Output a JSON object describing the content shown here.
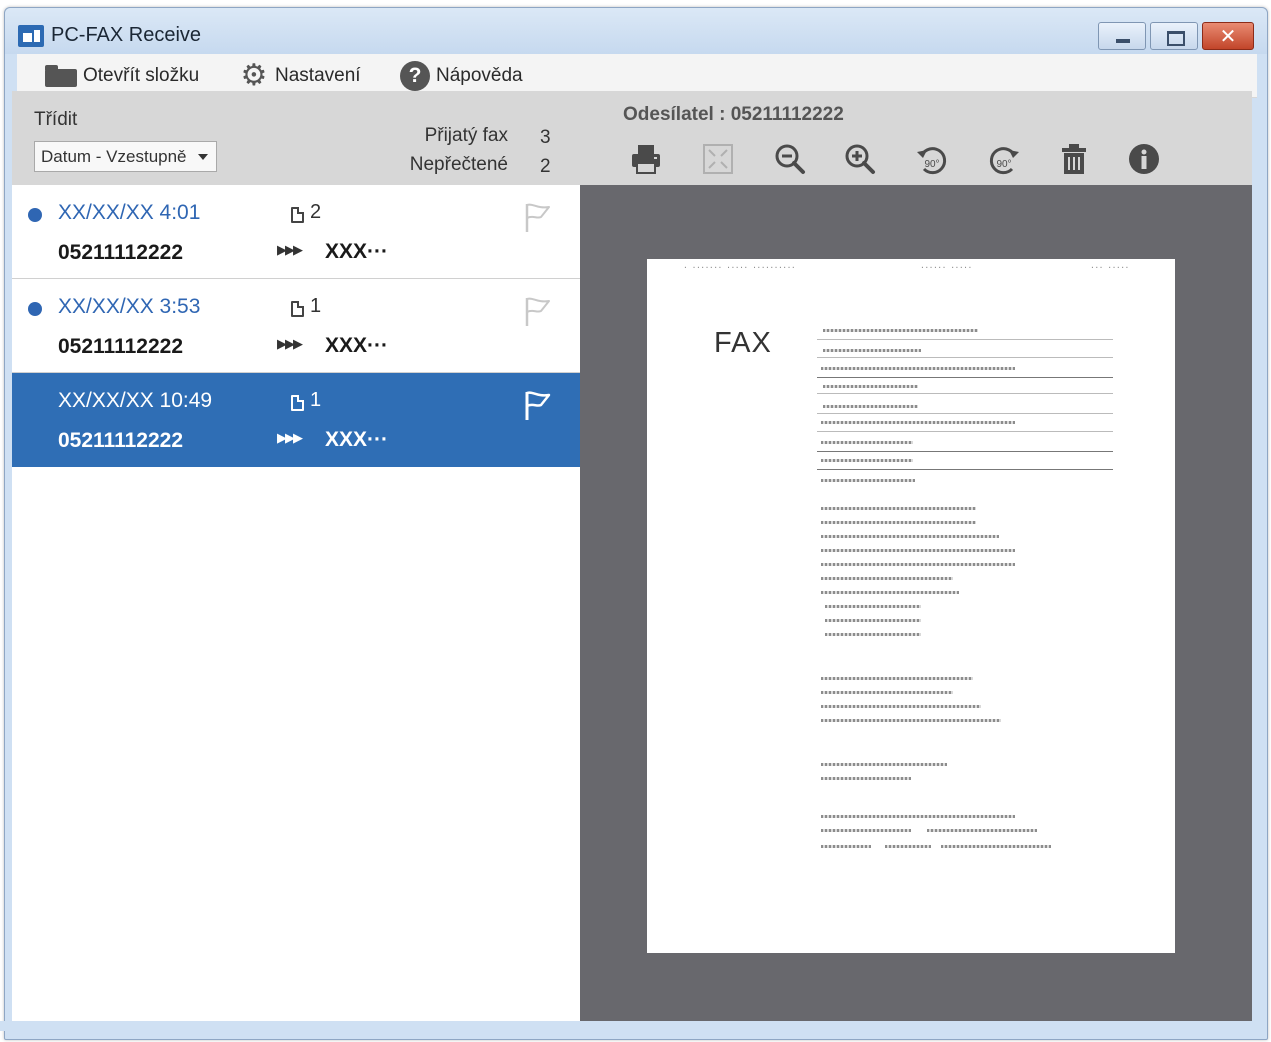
{
  "window": {
    "title": "PC-FAX Receive"
  },
  "toolbar": {
    "open_folder": "Otevřít složku",
    "settings": "Nastavení",
    "help": "Nápověda"
  },
  "sort": {
    "label": "Třídit",
    "selected": "Datum - Vzestupně"
  },
  "stats": {
    "received_label": "Přijatý fax",
    "received_value": "3",
    "unread_label": "Nepřečtené",
    "unread_value": "2"
  },
  "fax_list": [
    {
      "date": "XX/XX/XX 4:01",
      "pages": "2",
      "number": "05211112222",
      "subject": "XXX···",
      "unread": true,
      "selected": false,
      "flagged": false
    },
    {
      "date": "XX/XX/XX 3:53",
      "pages": "1",
      "number": "05211112222",
      "subject": "XXX···",
      "unread": true,
      "selected": false,
      "flagged": false
    },
    {
      "date": "XX/XX/XX 10:49",
      "pages": "1",
      "number": "05211112222",
      "subject": "XXX···",
      "unread": false,
      "selected": true,
      "flagged": true
    }
  ],
  "viewer": {
    "sender_label": "Odesílatel :",
    "sender_value": "05211112222",
    "rotate_left_label": "90°",
    "rotate_right_label": "90°",
    "tools": [
      "print-icon",
      "fit-page-icon",
      "zoom-out-icon",
      "zoom-in-icon",
      "rotate-left-icon",
      "rotate-right-icon",
      "trash-icon",
      "info-icon"
    ]
  },
  "fax_document": {
    "heading": "FAX"
  },
  "colors": {
    "selection": "#2f6eb5",
    "unread_accent": "#2f66b3",
    "viewer_background": "#68686d",
    "header_gray": "#d7d7d7"
  }
}
